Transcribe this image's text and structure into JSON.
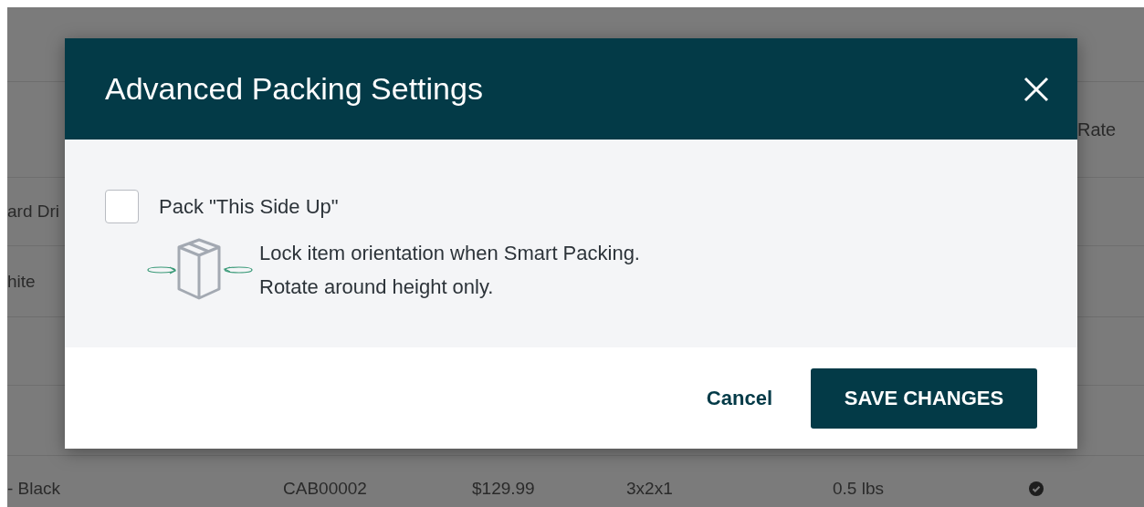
{
  "background_table": {
    "header": "Rate",
    "rows": [
      {
        "column_1": "ard Dri"
      },
      {
        "column_1": "hite"
      },
      {
        "column_1": "- Black",
        "column_2": "CAB00002",
        "column_3": "$129.99",
        "column_4": "3x2x1",
        "column_5": "0.5 lbs",
        "checked": true
      }
    ]
  },
  "dialog": {
    "title": "Advanced Packing Settings",
    "options": [
      {
        "label": "Pack \"This Side Up\"",
        "checked": false,
        "description": [
          "Lock item orientation when Smart Packing.",
          "Rotate around height only."
        ]
      }
    ],
    "buttons": [
      {
        "label": "Cancel",
        "kind": "link"
      },
      {
        "label": "SAVE CHANGES",
        "kind": "primary"
      }
    ]
  }
}
